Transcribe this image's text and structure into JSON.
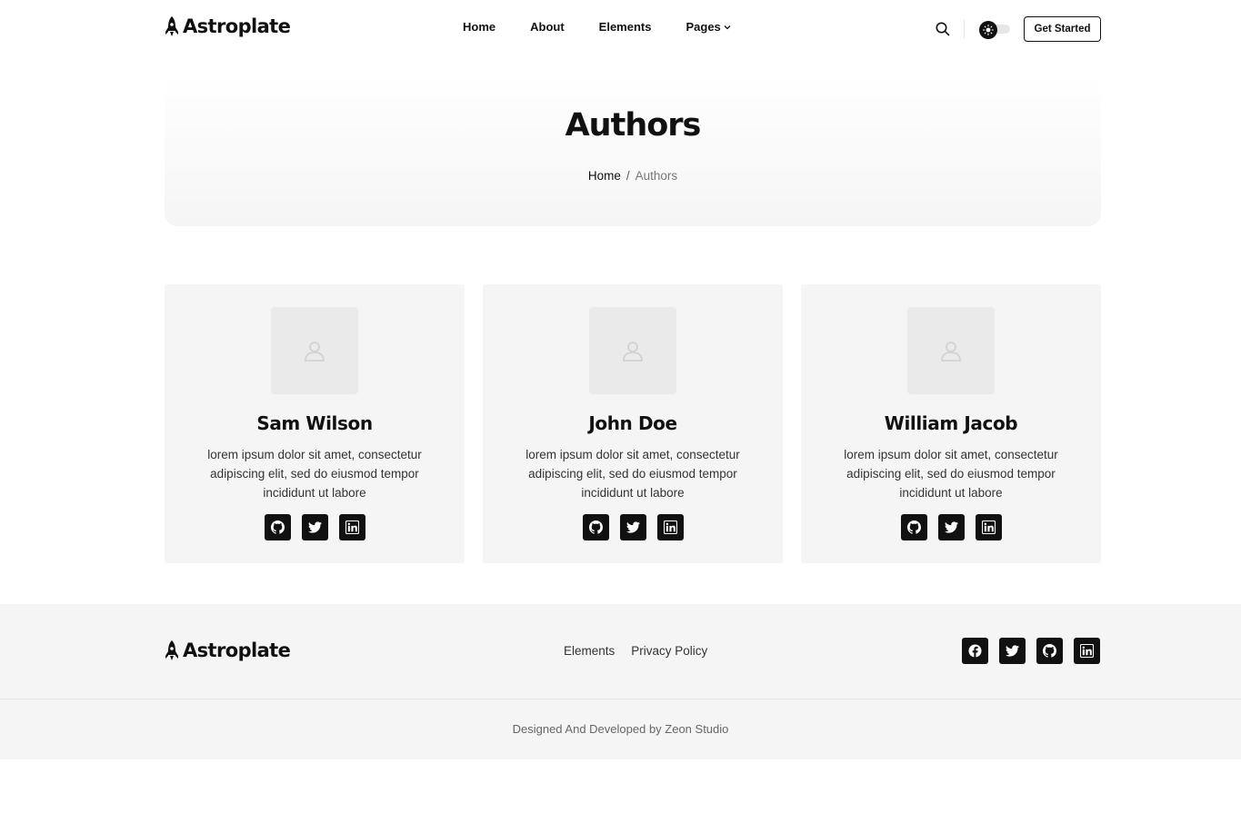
{
  "brand": {
    "name": "Astroplate"
  },
  "nav": {
    "items": [
      {
        "label": "Home"
      },
      {
        "label": "About"
      },
      {
        "label": "Elements"
      },
      {
        "label": "Pages"
      }
    ],
    "cta_label": "Get Started"
  },
  "hero": {
    "title": "Authors",
    "breadcrumb": {
      "home": "Home",
      "separator": "/",
      "current": "Authors"
    }
  },
  "authors": [
    {
      "name": "Sam Wilson",
      "bio": "lorem ipsum dolor sit amet, consectetur adipiscing elit, sed do eiusmod tempor incididunt ut labore",
      "socials": [
        "github-icon",
        "twitter-icon",
        "linkedin-icon"
      ]
    },
    {
      "name": "John Doe",
      "bio": "lorem ipsum dolor sit amet, consectetur adipiscing elit, sed do eiusmod tempor incididunt ut labore",
      "socials": [
        "github-icon",
        "twitter-icon",
        "linkedin-icon"
      ]
    },
    {
      "name": "William Jacob",
      "bio": "lorem ipsum dolor sit amet, consectetur adipiscing elit, sed do eiusmod tempor incididunt ut labore",
      "socials": [
        "github-icon",
        "twitter-icon",
        "linkedin-icon"
      ]
    }
  ],
  "footer": {
    "links": [
      {
        "label": "Elements"
      },
      {
        "label": "Privacy Policy"
      }
    ],
    "socials": [
      "facebook-icon",
      "twitter-icon",
      "github-icon",
      "linkedin-icon"
    ],
    "copyright": "Designed And Developed by Zeon Studio"
  },
  "colors": {
    "accent": "#111111",
    "surface": "#f5f5f5",
    "background": "#ffffff"
  }
}
